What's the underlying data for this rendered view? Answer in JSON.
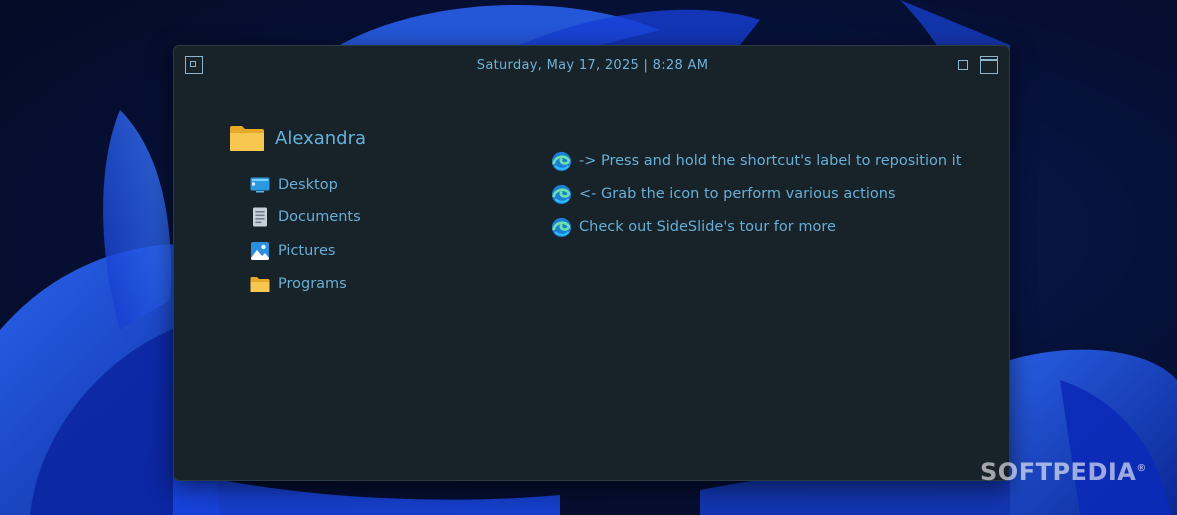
{
  "window": {
    "datetime": "Saturday, May 17, 2025 | 8:28 AM"
  },
  "user": {
    "name": "Alexandra",
    "icon": "folder-icon"
  },
  "nav_items": [
    {
      "label": "Desktop",
      "icon": "desktop-icon"
    },
    {
      "label": "Documents",
      "icon": "documents-icon"
    },
    {
      "label": "Pictures",
      "icon": "pictures-icon"
    },
    {
      "label": "Programs",
      "icon": "folder-icon"
    }
  ],
  "tips": [
    {
      "label": "-> Press and hold the shortcut's label to reposition it",
      "icon": "edge-icon"
    },
    {
      "label": "<- Grab the icon to perform various actions",
      "icon": "edge-icon"
    },
    {
      "label": "Check out SideSlide's tour for more",
      "icon": "edge-icon"
    }
  ],
  "watermark": "SOFTPEDIA",
  "colors": {
    "window_bg": "#172229",
    "accent_text": "#68afd6",
    "folder_yellow": "#f5c346",
    "wallpaper_blue": "#1f4fe0"
  }
}
